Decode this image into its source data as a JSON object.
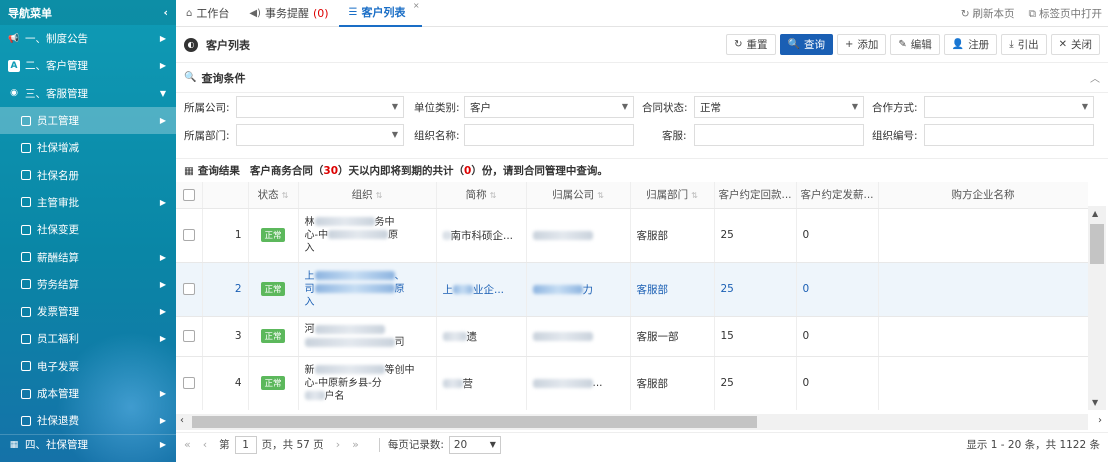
{
  "sidebar": {
    "title": "导航菜单",
    "collapse_icon": "chevron-left-icon",
    "groups": [
      {
        "label": "一、制度公告",
        "icon": "megaphone-icon"
      },
      {
        "label": "二、客户管理",
        "icon": "letter-a-icon"
      },
      {
        "label": "三、客服管理",
        "icon": "user-circle-icon"
      }
    ],
    "items": [
      {
        "label": "员工管理",
        "active": true,
        "arrow": true
      },
      {
        "label": "社保增减",
        "arrow": false
      },
      {
        "label": "社保名册",
        "arrow": false
      },
      {
        "label": "主管审批",
        "arrow": true
      },
      {
        "label": "社保变更",
        "arrow": false
      },
      {
        "label": "薪酬结算",
        "arrow": true
      },
      {
        "label": "劳务结算",
        "arrow": true
      },
      {
        "label": "发票管理",
        "arrow": true
      },
      {
        "label": "员工福利",
        "arrow": true
      },
      {
        "label": "电子发票",
        "arrow": false
      },
      {
        "label": "成本管理",
        "arrow": true
      },
      {
        "label": "社保退费",
        "arrow": true
      }
    ],
    "bottom_group": {
      "label": "四、社保管理"
    }
  },
  "tabs": {
    "workbench": "工作台",
    "reminder": "事务提醒",
    "reminder_count": "(0)",
    "customer_list": "客户列表",
    "close": "×",
    "refresh": "刷新本页",
    "open_new": "标签页中打开"
  },
  "page": {
    "title": "客户列表",
    "buttons": {
      "reset": "重置",
      "query": "查询",
      "add": "添加",
      "edit": "编辑",
      "register": "注册",
      "export": "引出",
      "close": "关闭"
    }
  },
  "query": {
    "title": "查询条件",
    "labels": {
      "company": "所属公司:",
      "unit_type": "单位类别:",
      "contract_status": "合同状态:",
      "coop_mode": "合作方式:",
      "department": "所属部门:",
      "org_name": "组织名称:",
      "service": "客服:",
      "org_code": "组织编号:"
    },
    "values": {
      "company": "",
      "unit_type": "客户",
      "contract_status": "正常",
      "coop_mode": "",
      "department": "",
      "org_name": "",
      "service": "",
      "org_code": ""
    }
  },
  "result": {
    "title": "查询结果",
    "msg_pre": "客户商务合同（",
    "days": "30",
    "msg_mid": "）天以内即将到期的共计（",
    "count": "0",
    "msg_post": "）份，请到合同管理中查询。"
  },
  "table": {
    "columns": [
      "状态",
      "组织",
      "简称",
      "归属公司",
      "归属部门",
      "客户约定回款...",
      "客户约定发薪...",
      "购方企业名称"
    ],
    "sort_icon": "sort-icon",
    "status_badge": "正常",
    "rows": [
      {
        "no": "1",
        "org_a": "林",
        "org_b": "务中",
        "org_c": "心-中",
        "org_d": "原",
        "org_e": "入",
        "abbr_a": "南市",
        "abbr_b": "科硕企...",
        "company": "",
        "dept": "客服部",
        "days1": "25",
        "days2": "0"
      },
      {
        "no": "2",
        "org_a": "上",
        "org_b": "、",
        "org_c": "司",
        "org_d": "原",
        "org_e": "入",
        "abbr_a": "上",
        "abbr_b": "业企...",
        "company": "力",
        "dept": "客服部",
        "days1": "25",
        "days2": "0"
      },
      {
        "no": "3",
        "org_a": "河",
        "org_b": "司",
        "org_c": "",
        "org_d": "",
        "org_e": "",
        "abbr_a": "",
        "abbr_b": "遗",
        "company": "",
        "dept": "客服一部",
        "days1": "15",
        "days2": "0"
      },
      {
        "no": "4",
        "org_a": "新",
        "org_b": "等创中",
        "org_c": "心-中原新乡县-分",
        "org_d": "",
        "org_e": "户名",
        "abbr_a": "",
        "abbr_b": "营",
        "company": "...",
        "dept": "客服部",
        "days1": "25",
        "days2": "0"
      }
    ]
  },
  "pager": {
    "page_label": "第",
    "page": "1",
    "total_label": "页，共 57 页",
    "size_label": "每页记录数:",
    "size": "20",
    "summary": "显示 1 - 20 条，共 1122 条"
  },
  "colors": {
    "accent": "#1a5fb4",
    "sidebar": "#0f9bb5",
    "badge": "#5cb85c",
    "alert": "#d00000"
  }
}
